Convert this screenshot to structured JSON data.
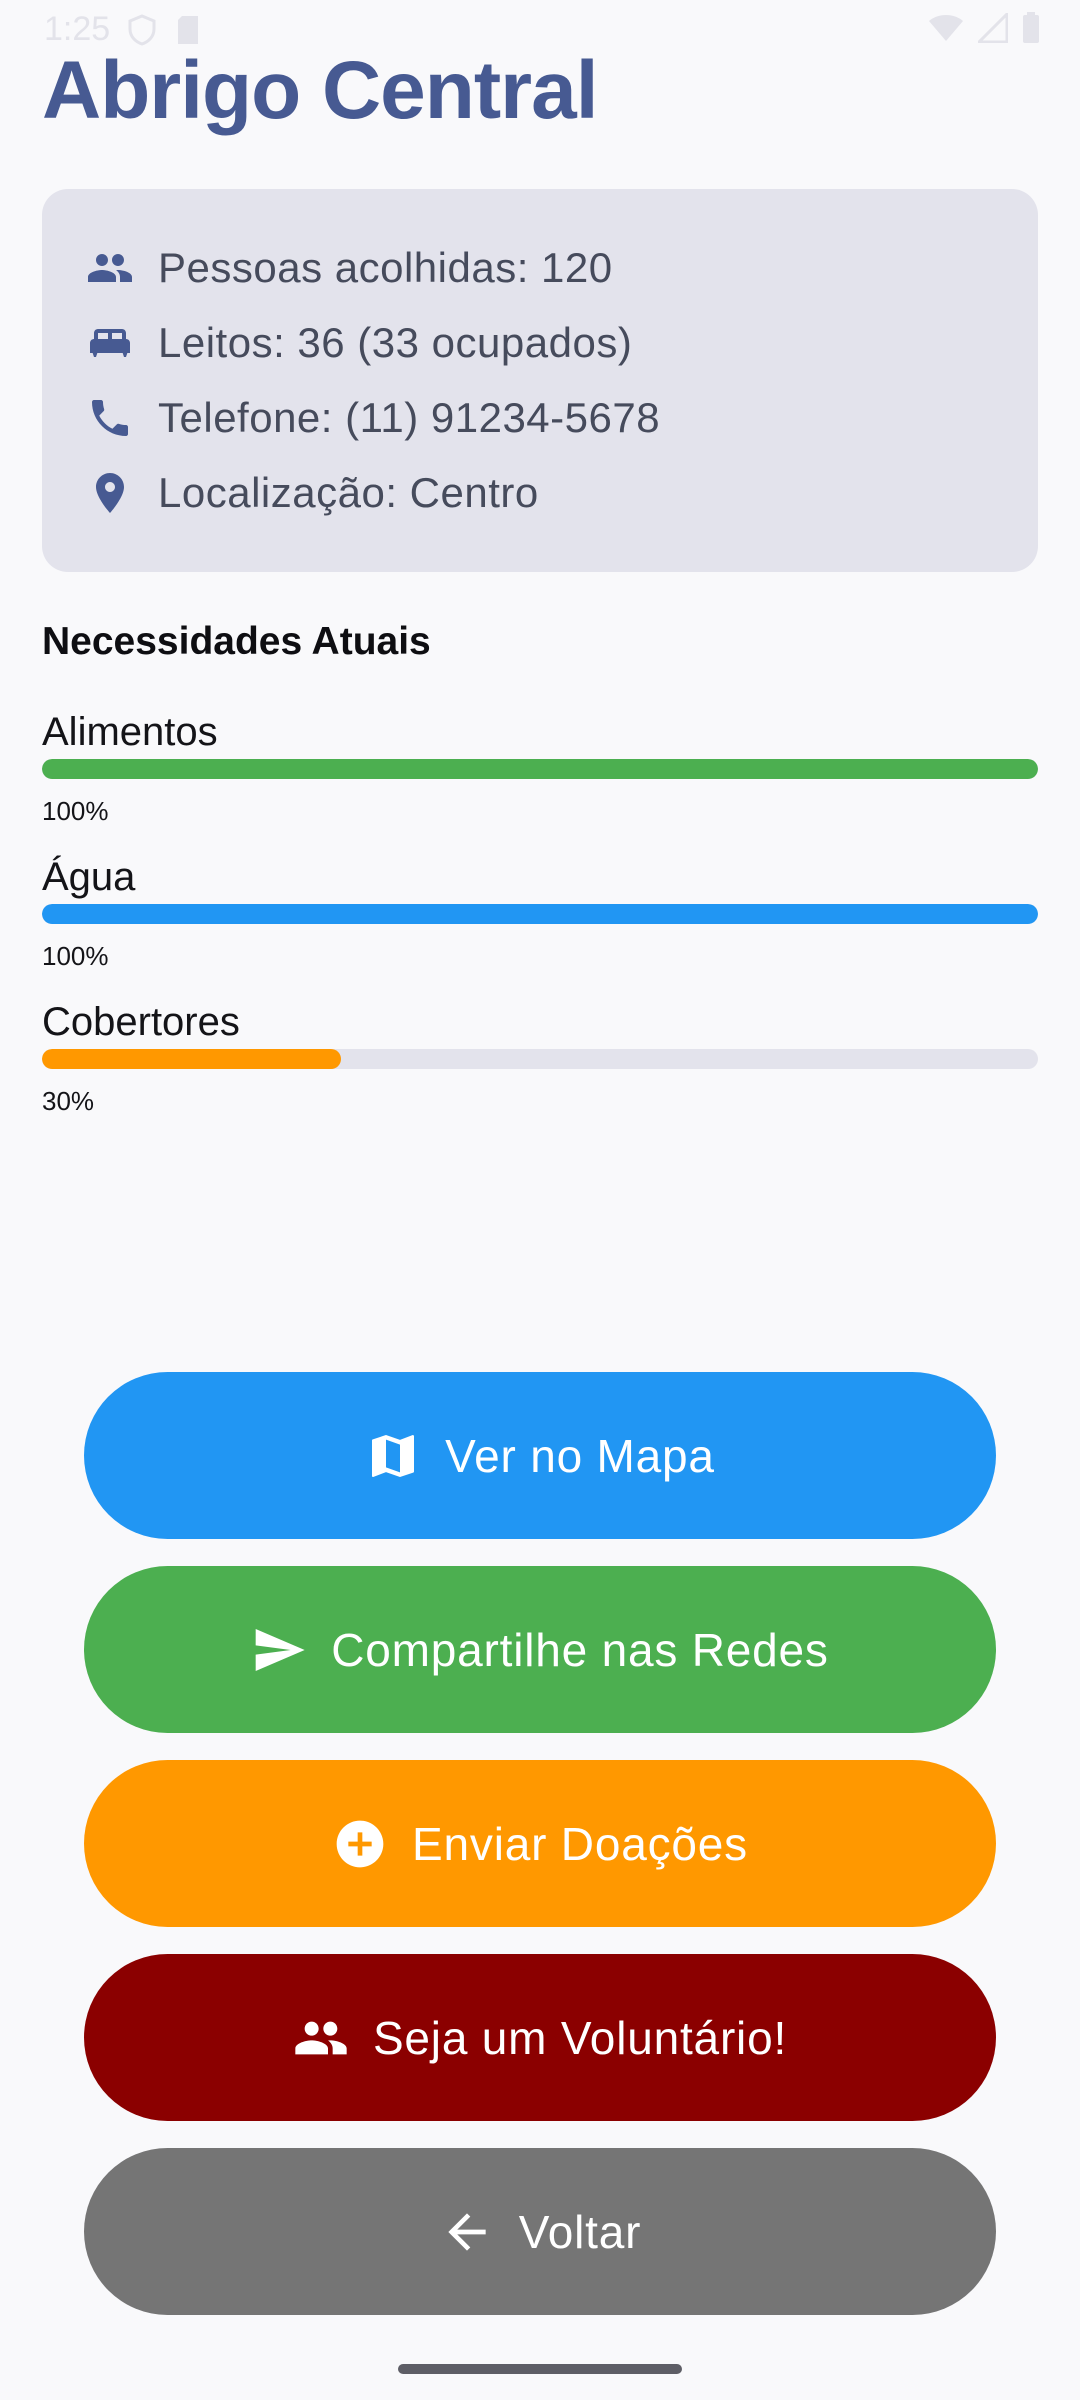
{
  "status_bar": {
    "time": "1:25"
  },
  "page": {
    "title": "Abrigo Central"
  },
  "info": {
    "people": "Pessoas acolhidas: 120",
    "beds": "Leitos: 36 (33 ocupados)",
    "phone": "Telefone: (11) 91234-5678",
    "location": "Localização: Centro",
    "icon_color": "#475A92"
  },
  "needs": {
    "title": "Necessidades Atuais",
    "items": [
      {
        "label": "Alimentos",
        "percent_text": "100%",
        "level": 1.0,
        "color": "#4CAF50"
      },
      {
        "label": "Água",
        "percent_text": "100%",
        "level": 1.0,
        "color": "#2196F3"
      },
      {
        "label": "Cobertores",
        "percent_text": "30%",
        "level": 0.3,
        "color": "#FF9800"
      }
    ]
  },
  "buttons": {
    "map": {
      "label": "Ver no Mapa",
      "icon": "map-icon",
      "color": "#2196F3"
    },
    "share": {
      "label": "Compartilhe nas Redes",
      "icon": "send-icon",
      "color": "#4CAF50"
    },
    "donate": {
      "label": "Enviar Doações",
      "icon": "add-circle-icon",
      "color": "#FF9800"
    },
    "volunteer": {
      "label": "Seja um Voluntário!",
      "icon": "people-icon",
      "color": "#8B0000"
    },
    "back": {
      "label": "Voltar",
      "icon": "arrow-back-icon",
      "color": "#757575"
    }
  }
}
